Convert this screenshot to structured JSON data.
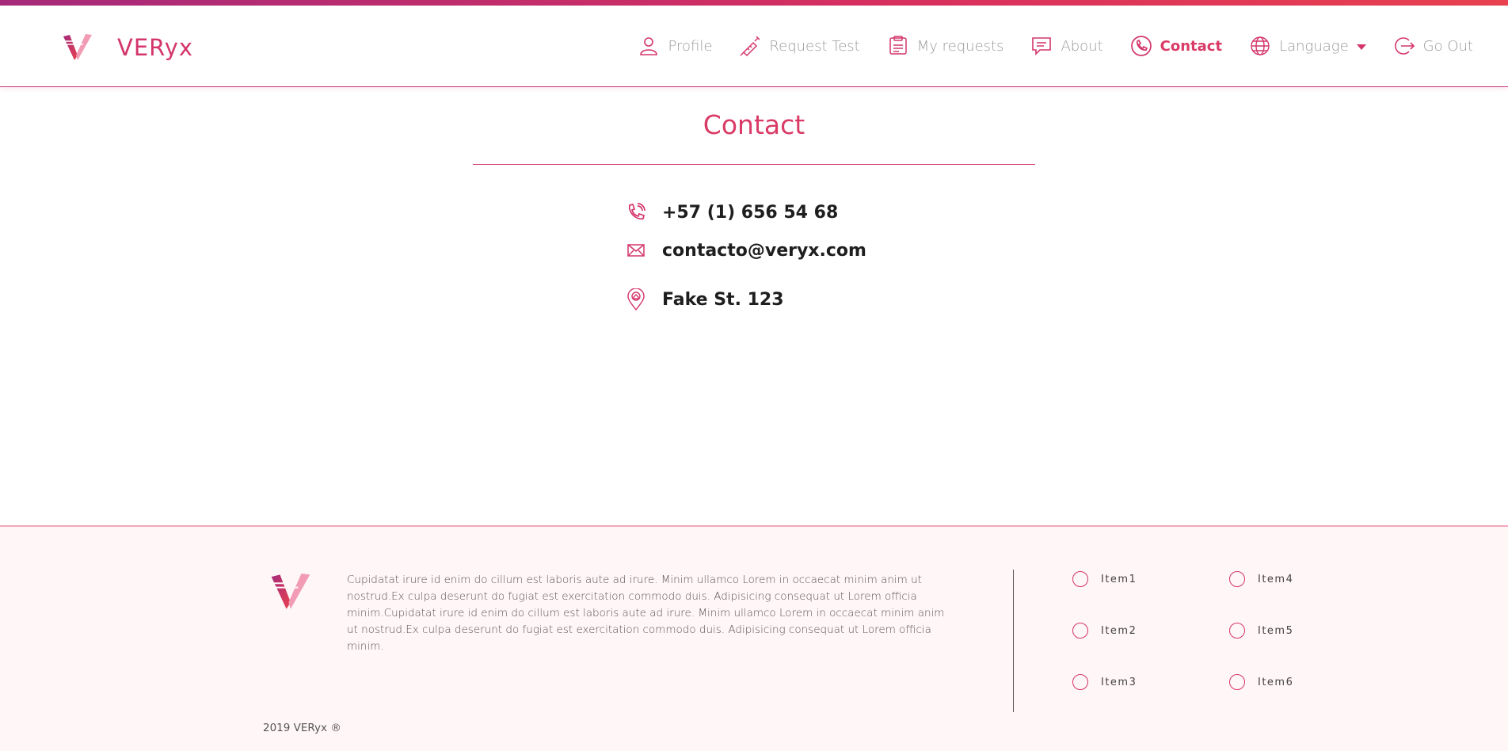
{
  "brand": {
    "name": "VERyx",
    "logo_icon": "veryx-v-logo"
  },
  "colors": {
    "accent": "#d93b66",
    "accent_dark": "#a52a7a",
    "footer_bg": "#fff6f8",
    "muted_text": "#9a9a9a"
  },
  "nav": {
    "items": [
      {
        "label": "Profile",
        "icon": "user-icon",
        "active": false
      },
      {
        "label": "Request Test",
        "icon": "syringe-icon",
        "active": false
      },
      {
        "label": "My requests",
        "icon": "clipboard-icon",
        "active": false
      },
      {
        "label": "About",
        "icon": "chat-icon",
        "active": false
      },
      {
        "label": "Contact",
        "icon": "phone-icon",
        "active": true
      },
      {
        "label": "Language",
        "icon": "globe-icon",
        "active": false,
        "dropdown": true
      },
      {
        "label": "Go Out",
        "icon": "logout-icon",
        "active": false
      }
    ]
  },
  "main": {
    "title": "Contact",
    "contacts": [
      {
        "icon": "phone-icon",
        "text": "+57 (1) 656 54 68"
      },
      {
        "icon": "mail-icon",
        "text": "contacto@veryx.com"
      },
      {
        "icon": "location-pin-icon",
        "text": "Fake St. 123"
      }
    ]
  },
  "footer": {
    "text": "Cupidatat irure id enim do cillum est laboris aute ad irure. Minim ullamco Lorem in occaecat minim anim ut nostrud.Ex culpa deserunt do fugiat est exercitation commodo duis. Adipisicing consequat ut Lorem officia minim.Cupidatat irure id enim do cillum est laboris aute ad irure. Minim ullamco Lorem in occaecat minim anim ut nostrud.Ex culpa deserunt do fugiat est exercitation commodo duis. Adipisicing consequat ut Lorem officia minim.",
    "items": [
      "Item1",
      "Item2",
      "Item3",
      "Item4",
      "Item5",
      "Item6"
    ],
    "copyright": "2019 VERyx ®"
  }
}
